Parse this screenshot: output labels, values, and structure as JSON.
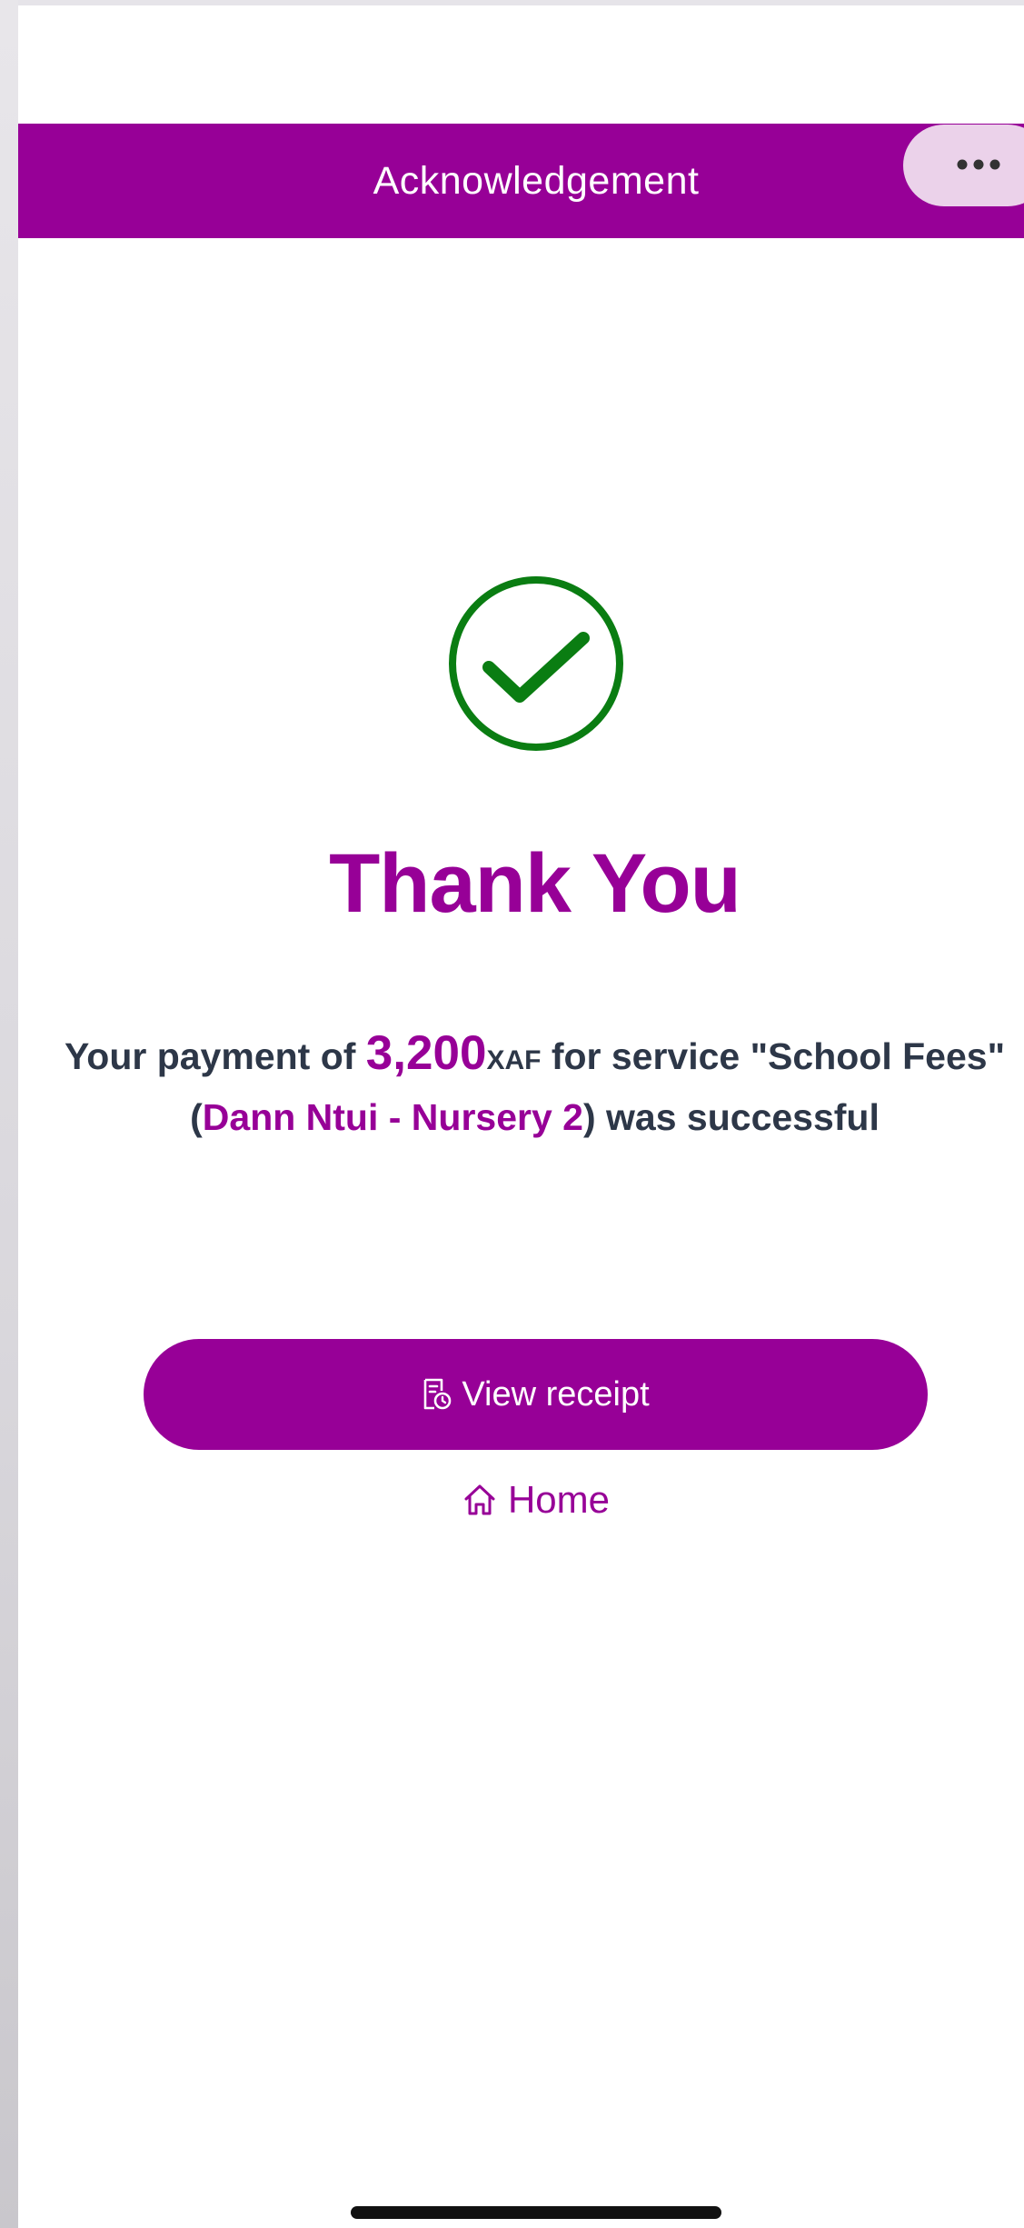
{
  "header": {
    "title": "Acknowledgement",
    "menu_icon": "more-horizontal-icon"
  },
  "status_icon": "check-circle-icon",
  "colors": {
    "brand": "#970097",
    "success": "#0a7d12",
    "text": "#2d3748",
    "menu_pill": "#ebd2ea"
  },
  "confirmation": {
    "heading": "Thank You",
    "message_prefix": "Your payment of ",
    "amount": "3,200",
    "currency": "XAF",
    "message_middle": " for service \"School Fees\" (",
    "student": "Dann Ntui - Nursery 2",
    "message_suffix": ") was successful"
  },
  "actions": {
    "view_receipt_label": "View receipt",
    "view_receipt_icon": "receipt-icon",
    "home_label": "Home",
    "home_icon": "home-icon"
  }
}
